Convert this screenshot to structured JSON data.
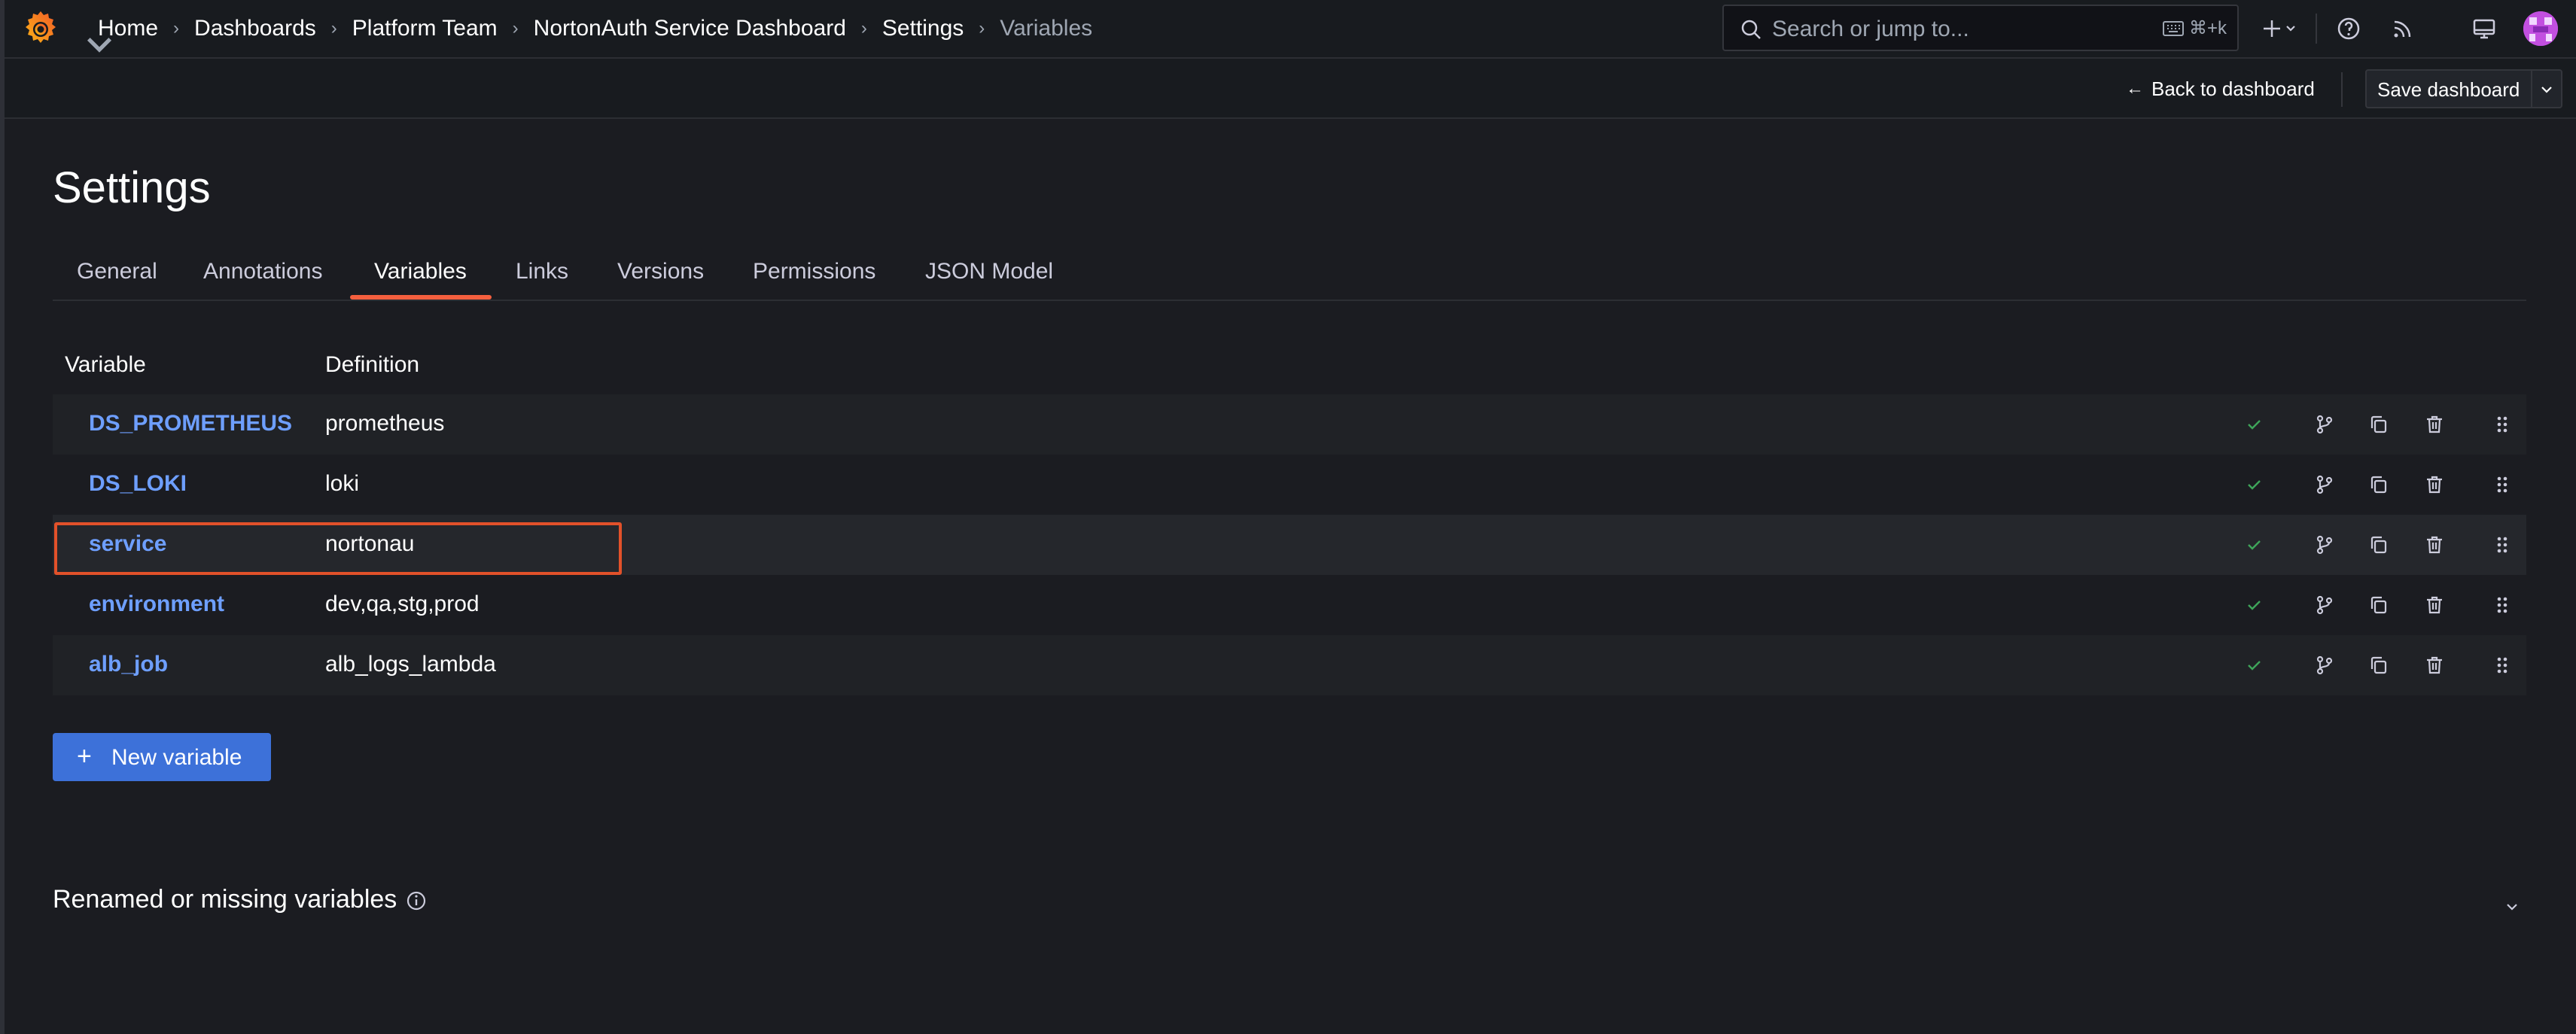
{
  "topbar": {
    "breadcrumbs": [
      "Home",
      "Dashboards",
      "Platform Team",
      "NortonAuth Service Dashboard",
      "Settings",
      "Variables"
    ],
    "search_placeholder": "Search or jump to...",
    "search_shortcut": "⌘+k"
  },
  "subbar": {
    "back_label": "Back to dashboard",
    "save_label": "Save dashboard"
  },
  "page": {
    "title": "Settings",
    "tabs": [
      "General",
      "Annotations",
      "Variables",
      "Links",
      "Versions",
      "Permissions",
      "JSON Model"
    ],
    "active_tab": "Variables"
  },
  "table": {
    "headers": [
      "Variable",
      "Definition"
    ],
    "rows": [
      {
        "name": "DS_PROMETHEUS",
        "definition": "prometheus"
      },
      {
        "name": "DS_LOKI",
        "definition": "loki"
      },
      {
        "name": "service",
        "definition": "nortonau"
      },
      {
        "name": "environment",
        "definition": "dev,qa,stg,prod"
      },
      {
        "name": "alb_job",
        "definition": "alb_logs_lambda"
      }
    ],
    "highlighted_row": "service"
  },
  "actions": {
    "new_variable": "New variable"
  },
  "footer": {
    "renamed_title": "Renamed or missing variables"
  },
  "colors": {
    "accent": "#f55f3e",
    "link": "#6e9fff",
    "primary_button": "#3d71d9",
    "ok": "#3ea55a",
    "highlight_box": "#e2512a"
  },
  "icons": [
    "grafana-logo",
    "chevron-down-icon",
    "search-icon",
    "keyboard-icon",
    "plus-icon",
    "help-icon",
    "rss-icon",
    "monitor-icon",
    "avatar",
    "arrow-left-icon",
    "check-icon",
    "branch-icon",
    "copy-icon",
    "trash-icon",
    "drag-handle-icon",
    "info-icon"
  ]
}
